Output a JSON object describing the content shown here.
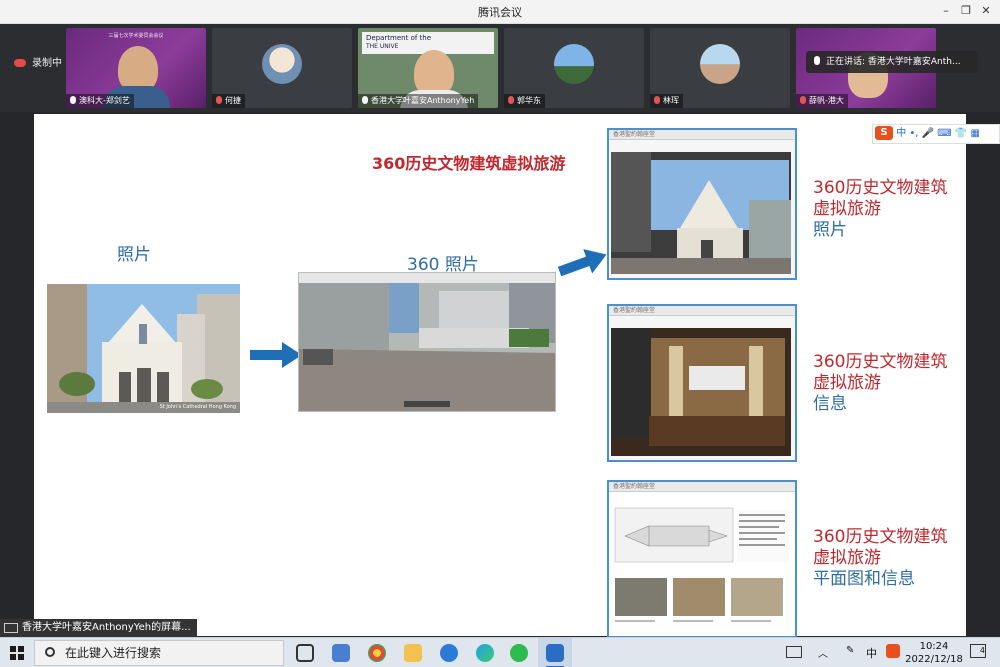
{
  "window": {
    "title": "腾讯会议"
  },
  "meeting": {
    "recording_label": "录制中",
    "speaking_label": "正在讲话: 香港大学叶嘉安Anth...",
    "participants": [
      {
        "name": "澳科大-郑剑艺",
        "mic": "on"
      },
      {
        "name": "何捷",
        "mic": "off"
      },
      {
        "name": "香港大学叶嘉安AnthonyYeh",
        "mic": "on"
      },
      {
        "name": "郭华东",
        "mic": "off"
      },
      {
        "name": "林珲",
        "mic": "off"
      },
      {
        "name": "薛帆-港大",
        "mic": "off"
      }
    ],
    "tile1_banner_line1": "三届七次学术委员会会议",
    "tile3_sign": "Department of the",
    "tile3_sign2": "THE UNIVE"
  },
  "slide": {
    "title": "360历史文物建筑虚拟旅游",
    "label_photo": "照片",
    "label_360": "360 照片",
    "photo_caption": "St John's Cathedral Hong Kong",
    "captions": [
      {
        "line1": "360历史文物建筑",
        "line2": "虚拟旅游",
        "line3": "照片"
      },
      {
        "line1": "360历史文物建筑",
        "line2": "虚拟旅游",
        "line3": "信息"
      },
      {
        "line1": "360历史文物建筑",
        "line2": "虚拟旅游",
        "line3": "平面图和信息"
      }
    ],
    "thumb_header": "香港聖約翰座堂",
    "ime_label": "中"
  },
  "share": {
    "label": "香港大学叶嘉安AnthonyYeh的屏幕..."
  },
  "taskbar": {
    "search_placeholder": "在此键入进行搜索",
    "ime": "中",
    "time": "10:24",
    "date": "2022/12/18",
    "notification_count": "4"
  },
  "colors": {
    "accent_blue": "#2e6da4",
    "accent_red": "#c0282e",
    "thumb_border": "#4a8fd0"
  }
}
